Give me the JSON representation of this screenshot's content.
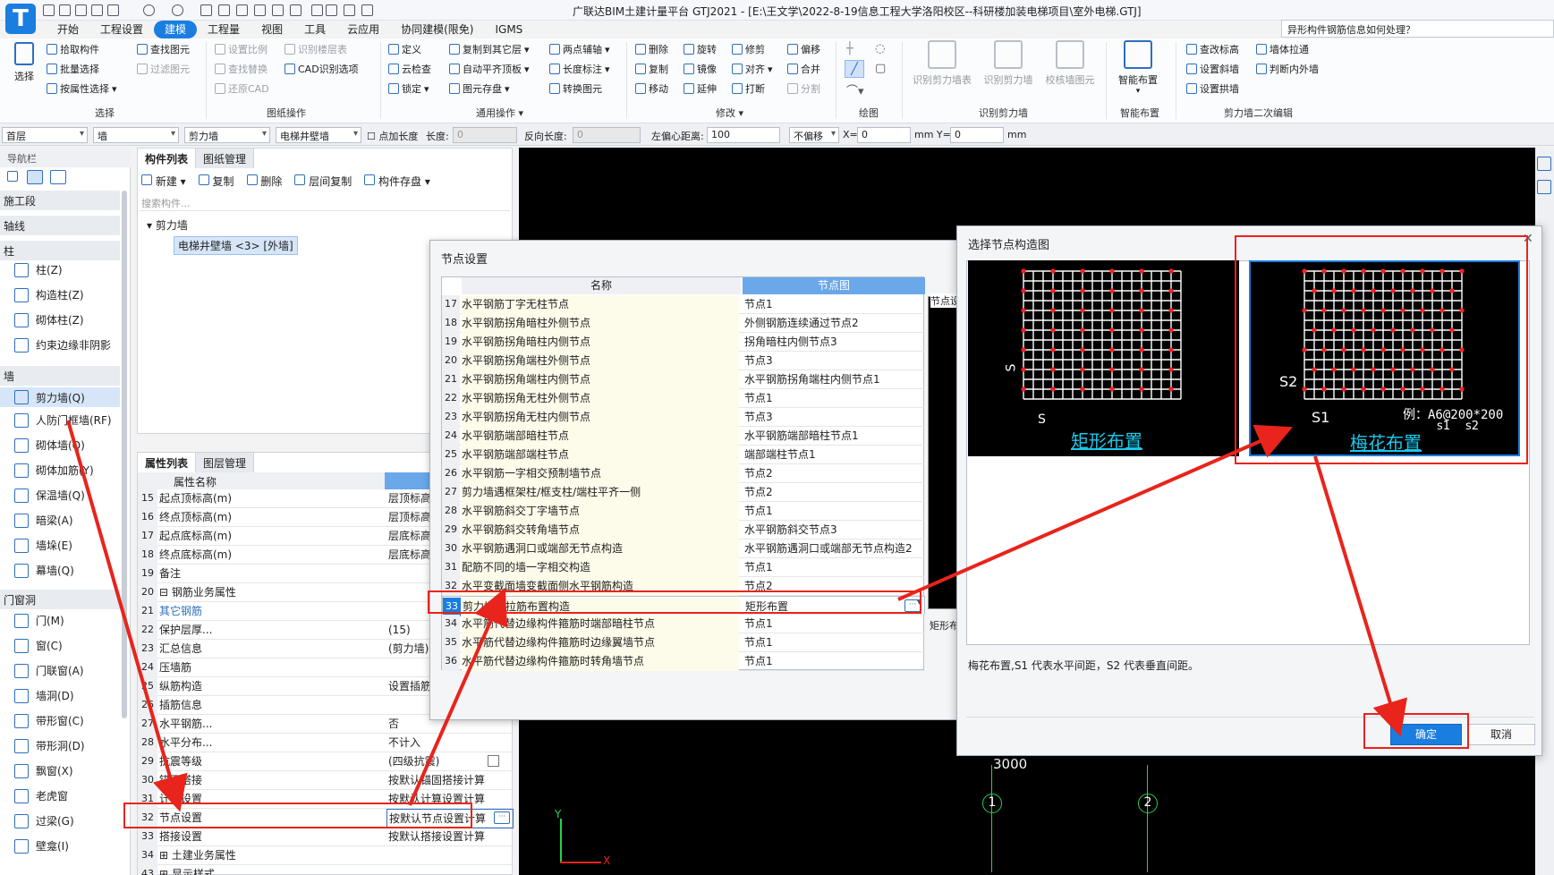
{
  "app": {
    "title": "广联达BIM土建计量平台 GTJ2021 - [E:\\王文学\\2022-8-19信息工程大学洛阳校区--科研楼加装电梯项目\\室外电梯.GTJ]",
    "help_placeholder": "异形构件钢筋信息如何处理？"
  },
  "menu": [
    "开始",
    "工程设置",
    "建模",
    "工程量",
    "视图",
    "工具",
    "云应用",
    "协同建模(限免)",
    "IGMS"
  ],
  "ribbon": {
    "select_label": "选择",
    "groups": {
      "select": "选择",
      "drawing_ops": "图纸操作",
      "common_ops": "通用操作",
      "modify": "修改",
      "draw": "绘图",
      "identify_wall": "识别剪力墙",
      "smart_layout": "智能布置",
      "wall_edit": "剪力墙二次编辑"
    },
    "buttons": {
      "pick": "拾取构件",
      "batch": "批量选择",
      "by_prop": "按属性选择",
      "find_elem": "查找图元",
      "filter_elem": "过滤图元",
      "set_scale": "设置比例",
      "find_replace": "查找替换",
      "restore_cad": "还原CAD",
      "identify_floor": "识别楼层表",
      "cad_options": "CAD识别选项",
      "define": "定义",
      "cloud_check": "云检查",
      "lock": "锁定",
      "copy_to_floor": "复制到其它层",
      "auto_flat": "自动平齐顶板",
      "elem_save": "图元存盘",
      "two_point_axis": "两点辅轴",
      "length_mark": "长度标注",
      "convert_elem": "转换图元",
      "delete": "删除",
      "copy": "复制",
      "move": "移动",
      "rotate": "旋转",
      "mirror": "镜像",
      "extend": "延伸",
      "trim": "修剪",
      "align": "对齐",
      "break": "打断",
      "offset": "偏移",
      "merge": "合并",
      "split": "分割",
      "id_wall_table": "识别剪力墙表",
      "id_wall": "识别剪力墙",
      "check_wall": "校核墙图元",
      "smart_layout": "智能布置",
      "check_elev": "查改标高",
      "set_slope": "设置斜墙",
      "set_arch": "设置拱墙",
      "wall_pull": "墙体拉通",
      "judge_outer": "判断内外墙"
    }
  },
  "propbar": {
    "floor": "首层",
    "type": "墙",
    "subtype": "剪力墙",
    "component": "电梯井壁墙",
    "add_length": "点加长度",
    "length_label": "长度:",
    "length": "0",
    "reverse_label": "反向长度:",
    "reverse": "0",
    "left_offset_label": "左偏心距离:",
    "left_offset": "100",
    "no_offset": "不偏移",
    "x_label": "X=",
    "x": "0",
    "y_label": "mm Y=",
    "y": "0",
    "unit": "mm"
  },
  "nav": {
    "header": "导航栏",
    "categories": {
      "construction": "施工段",
      "axis": "轴线",
      "column": "柱",
      "wall": "墙",
      "door_window": "门窗洞"
    },
    "column_items": [
      "柱(Z)",
      "构造柱(Z)",
      "砌体柱(Z)",
      "约束边缘非阴影"
    ],
    "wall_items": [
      "剪力墙(Q)",
      "人防门框墙(RF)",
      "砌体墙(Q)",
      "砌体加筋(Y)",
      "保温墙(Q)",
      "暗梁(A)",
      "墙垛(E)",
      "幕墙(Q)"
    ],
    "door_items": [
      "门(M)",
      "窗(C)",
      "门联窗(A)",
      "墙洞(D)",
      "带形窗(C)",
      "带形洞(D)",
      "飘窗(X)",
      "老虎窗",
      "过梁(G)",
      "壁龛(I)"
    ]
  },
  "complist": {
    "tab1": "构件列表",
    "tab2": "图纸管理",
    "new": "新建",
    "copy": "复制",
    "delete": "删除",
    "floor_copy": "层间复制",
    "save": "构件存盘",
    "search_placeholder": "搜索构件...",
    "tree_root": "剪力墙",
    "tree_item": "电梯井壁墙 <3> [外墙]"
  },
  "proplist": {
    "tab1": "属性列表",
    "tab2": "图层管理",
    "col_name": "属性名称",
    "col_value": "属性值",
    "rows": [
      {
        "n": "15",
        "k": "起点顶标高(m)",
        "v": "层顶标高"
      },
      {
        "n": "16",
        "k": "终点顶标高(m)",
        "v": "层顶标高"
      },
      {
        "n": "17",
        "k": "起点底标高(m)",
        "v": "层底标高"
      },
      {
        "n": "18",
        "k": "终点底标高(m)",
        "v": "层底标高"
      },
      {
        "n": "19",
        "k": "备注",
        "v": ""
      },
      {
        "n": "20",
        "k": "⊟ 钢筋业务属性",
        "v": ""
      },
      {
        "n": "21",
        "k": "    其它钢筋",
        "v": ""
      },
      {
        "n": "22",
        "k": "    保护层厚...",
        "v": "(15)"
      },
      {
        "n": "23",
        "k": "    汇总信息",
        "v": "(剪力墙)"
      },
      {
        "n": "24",
        "k": "    压墙筋",
        "v": ""
      },
      {
        "n": "25",
        "k": "    纵筋构造",
        "v": "设置插筋"
      },
      {
        "n": "26",
        "k": "    插筋信息",
        "v": ""
      },
      {
        "n": "27",
        "k": "    水平钢筋...",
        "v": "否"
      },
      {
        "n": "28",
        "k": "    水平分布...",
        "v": "不计入"
      },
      {
        "n": "29",
        "k": "    抗震等级",
        "v": "(四级抗震)"
      },
      {
        "n": "30",
        "k": "    锚固搭接",
        "v": "按默认锚固搭接计算"
      },
      {
        "n": "31",
        "k": "    计算设置",
        "v": "按默认计算设置计算"
      },
      {
        "n": "32",
        "k": "    节点设置",
        "v": "按默认节点设置计算"
      },
      {
        "n": "33",
        "k": "    搭接设置",
        "v": "按默认搭接设置计算"
      },
      {
        "n": "34",
        "k": "⊞ 土建业务属性",
        "v": ""
      },
      {
        "n": "43",
        "k": "⊞ 显示样式",
        "v": ""
      }
    ]
  },
  "node_dialog": {
    "title": "节点设置",
    "col_name": "名称",
    "col_node": "节点图",
    "side_label": "节点设",
    "side_bottom": "矩形布",
    "rows": [
      {
        "n": "17",
        "k": "水平钢筋丁字无柱节点",
        "v": "节点1"
      },
      {
        "n": "18",
        "k": "水平钢筋拐角暗柱外侧节点",
        "v": "外侧钢筋连续通过节点2"
      },
      {
        "n": "19",
        "k": "水平钢筋拐角暗柱内侧节点",
        "v": "拐角暗柱内侧节点3"
      },
      {
        "n": "20",
        "k": "水平钢筋拐角端柱外侧节点",
        "v": "节点3"
      },
      {
        "n": "21",
        "k": "水平钢筋拐角端柱内侧节点",
        "v": "水平钢筋拐角端柱内侧节点1"
      },
      {
        "n": "22",
        "k": "水平钢筋拐角无柱外侧节点",
        "v": "节点1"
      },
      {
        "n": "23",
        "k": "水平钢筋拐角无柱内侧节点",
        "v": "节点3"
      },
      {
        "n": "24",
        "k": "水平钢筋端部暗柱节点",
        "v": "水平钢筋端部暗柱节点1"
      },
      {
        "n": "25",
        "k": "水平钢筋端部端柱节点",
        "v": "端部端柱节点1"
      },
      {
        "n": "26",
        "k": "水平钢筋一字相交预制墙节点",
        "v": "节点2"
      },
      {
        "n": "27",
        "k": "剪力墙遇框架柱/框支柱/端柱平齐一侧",
        "v": "节点2"
      },
      {
        "n": "28",
        "k": "水平钢筋斜交丁字墙节点",
        "v": "节点1"
      },
      {
        "n": "29",
        "k": "水平钢筋斜交转角墙节点",
        "v": "水平钢筋斜交节点3"
      },
      {
        "n": "30",
        "k": "水平钢筋遇洞口或端部无节点构造",
        "v": "水平钢筋遇洞口或端部无节点构造2"
      },
      {
        "n": "31",
        "k": "配筋不同的墙一字相交构造",
        "v": "节点1"
      },
      {
        "n": "32",
        "k": "水平变截面墙变截面侧水平钢筋构造",
        "v": "节点2"
      },
      {
        "n": "33",
        "k": "剪力墙身拉筋布置构造",
        "v": "矩形布置"
      },
      {
        "n": "34",
        "k": "水平筋代替边缘构件箍筋时端部暗柱节点",
        "v": "节点1"
      },
      {
        "n": "35",
        "k": "水平筋代替边缘构件箍筋时边缘翼墙节点",
        "v": "节点1"
      },
      {
        "n": "36",
        "k": "水平筋代替边缘构件箍筋时转角墙节点",
        "v": "节点1"
      }
    ]
  },
  "pick_dialog": {
    "title": "选择节点构造图",
    "opt1_caption": "矩形布置",
    "opt2_caption": "梅花布置",
    "opt1_s": "S",
    "opt2_s1": "S1",
    "opt2_s2": "S2",
    "example": "例：A6@200*200",
    "example_s1": "s1",
    "example_s2": "s2",
    "description": "梅花布置,S1 代表水平间距，S2 代表垂直间距。",
    "ok": "确定",
    "cancel": "取消"
  },
  "canvas": {
    "dim": "3000",
    "axis1": "1",
    "axis2": "2",
    "ucs_x": "X",
    "ucs_y": "Y"
  },
  "colors": {
    "accent": "#1a7de0",
    "annotation_red": "#e8241c",
    "cad_red_dot": "#ff2020",
    "cad_cyan": "#19c8ec",
    "cad_green": "#22d44a"
  }
}
